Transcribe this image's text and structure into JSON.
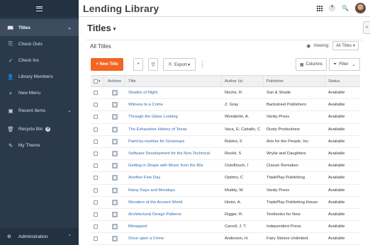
{
  "app": {
    "title": "Lending Library"
  },
  "sidebar": {
    "items": [
      {
        "icon": "book-icon",
        "glyph": "📖",
        "label": "Titles",
        "active": true,
        "chevron": "⌄"
      },
      {
        "icon": "checkout-icon",
        "glyph": "⎘",
        "label": "Check Outs"
      },
      {
        "icon": "check-icon",
        "glyph": "✓",
        "label": "Check Ins"
      },
      {
        "icon": "user-icon",
        "glyph": "👤",
        "label": "Library Members"
      },
      {
        "icon": "plus-icon",
        "glyph": "+",
        "label": "New Menu"
      },
      {
        "icon": "recent-icon",
        "glyph": "▣",
        "label": "Recent Items",
        "chevron": "⌄"
      },
      {
        "icon": "trash-icon",
        "glyph": "🗑",
        "label": "Recycle Bin",
        "badge": "0"
      },
      {
        "icon": "theme-icon",
        "glyph": "✎",
        "label": "My Theme"
      }
    ],
    "bottom": {
      "icon": "gears-icon",
      "glyph": "⚙",
      "label": "Administration",
      "chevron": "⌃"
    }
  },
  "header": {
    "help": "?",
    "search": "🔍"
  },
  "page": {
    "title": "Titles",
    "subtitle": "All Titles",
    "viewing_label": "Viewing:",
    "viewing_value": "All Titles ▾",
    "collapse": "«"
  },
  "toolbar": {
    "new_label": "+ New Title",
    "add": "+",
    "delete": "🗑",
    "export": "Export ▾",
    "columns": "Columns",
    "filter": "Filter"
  },
  "table": {
    "headers": [
      "Actions",
      "Title",
      "Author (s)",
      "Publisher",
      "Status"
    ],
    "rows": [
      [
        "Shades of Night",
        "Noche, R.",
        "Sun & Shade",
        "Available"
      ],
      [
        "Witness to a Crime",
        "Z. Gray",
        "Backstreet Publishers",
        "Available"
      ],
      [
        "Through the Glass Looking",
        "Wonderlin, A.",
        "Vanity Press",
        "Available"
      ],
      [
        "The Exhaustive History of Texas",
        "Vaca, E; Caballo, C",
        "Dusty Productions",
        "Available"
      ],
      [
        "Paint-by-number for Grownups",
        "Rubins, F.",
        "Arts for the People, Inc.",
        "Available"
      ],
      [
        "Software Development for the Non-Technical",
        "Rockit, S",
        "Wrylie and Daughters",
        "Available"
      ],
      [
        "Getting in Shape with Music from the 80s",
        "Outoftouch, I",
        "Classic Remakes",
        "Available"
      ],
      [
        "Another Fine Day",
        "Optimo, C",
        "TriplePlay Publishing",
        "Available"
      ],
      [
        "Rainy Days and Mondays",
        "Muddy, W.",
        "Vanity Press",
        "Available"
      ],
      [
        "Wonders of the Ancient World",
        "Histor, A.",
        "TriplePlay Publishing House",
        "Available"
      ],
      [
        "Architectural Design Patterns",
        "Digger, R.",
        "Textbooks for Now",
        "Available"
      ],
      [
        "Bitnapped",
        "Carroll, J. T.",
        "Independent Press",
        "Available"
      ],
      [
        "Once upon a Crime",
        "Anderson, H.",
        "Fairy Stories Unlimited",
        "Available"
      ]
    ]
  }
}
